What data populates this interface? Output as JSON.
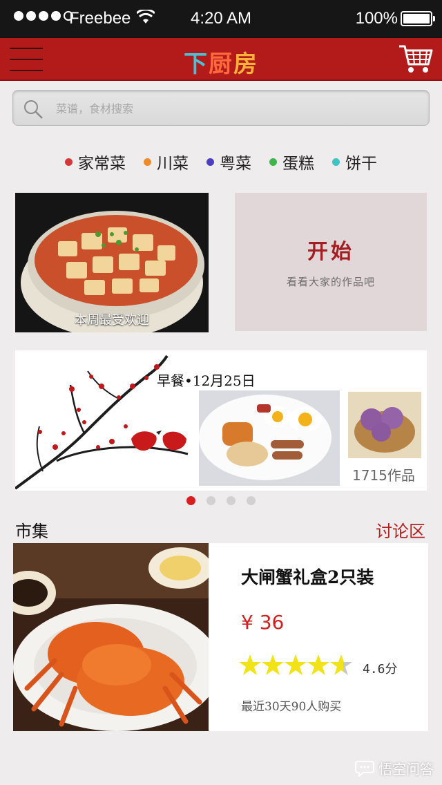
{
  "status_bar": {
    "carrier": "Freebee",
    "time": "4:20 AM",
    "battery": "100%"
  },
  "navbar": {
    "logo_chars": [
      "下",
      "厨",
      "房"
    ],
    "menu_icon": "menu-icon",
    "cart_icon": "shopping-cart-icon",
    "accent_color": "#b31b1b"
  },
  "search": {
    "placeholder": "菜谱，食材搜索",
    "icon": "search-icon"
  },
  "categories": [
    {
      "label": "家常菜",
      "color": "#d23a3a"
    },
    {
      "label": "川菜",
      "color": "#ef8a2a"
    },
    {
      "label": "粤菜",
      "color": "#4a3fbf"
    },
    {
      "label": "蛋糕",
      "color": "#3fb54a"
    },
    {
      "label": "饼干",
      "color": "#3ec3c3"
    }
  ],
  "featured": {
    "caption": "本周最受欢迎"
  },
  "start_tile": {
    "title": "开始",
    "subtitle": "看看大家的作品吧"
  },
  "banner": {
    "date_label": "早餐•12月25日",
    "works": "1715作品",
    "pages": 4,
    "active_page": 1
  },
  "market": {
    "title": "市集",
    "forum_link": "讨论区",
    "product": {
      "name": "大闸蟹礼盒2只装",
      "price": "¥ 36",
      "rating_value": 4.6,
      "rating": "4.6分",
      "sold": "最近30天90人购买"
    }
  },
  "watermark": "悟空问答"
}
